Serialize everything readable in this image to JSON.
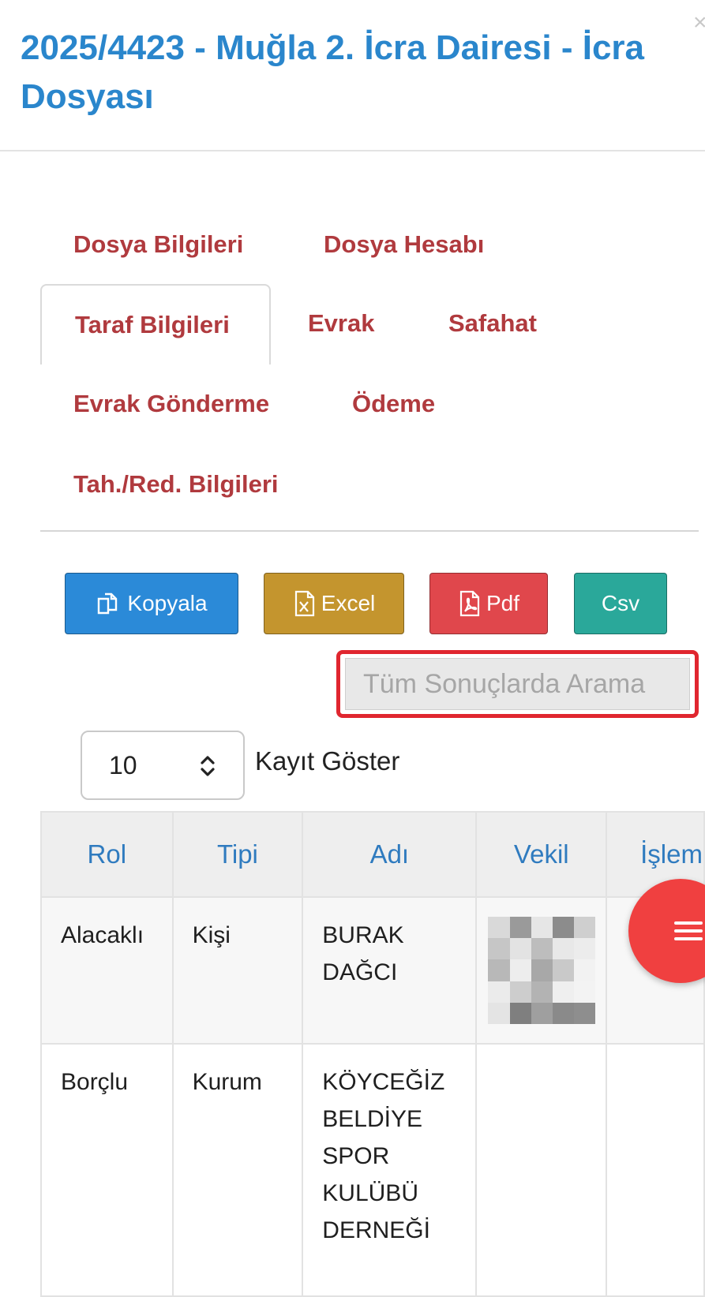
{
  "header": {
    "title": "2025/4423 - Muğla 2. İcra Dairesi - İcra Dosyası",
    "close_glyph": "×"
  },
  "tabs": [
    {
      "label": "Dosya Bilgileri",
      "active": false
    },
    {
      "label": "Dosya Hesabı",
      "active": false
    },
    {
      "label": "Taraf Bilgileri",
      "active": true
    },
    {
      "label": "Evrak",
      "active": false
    },
    {
      "label": "Safahat",
      "active": false
    },
    {
      "label": "Evrak Gönderme",
      "active": false
    },
    {
      "label": "Ödeme",
      "active": false
    },
    {
      "label": "Tah./Red. Bilgileri",
      "active": false
    }
  ],
  "export_buttons": [
    {
      "label": "Kopyala",
      "icon": "copy-icon",
      "color": "#2b8ad8"
    },
    {
      "label": "Excel",
      "icon": "excel-file-icon",
      "color": "#c4952e"
    },
    {
      "label": "Pdf",
      "icon": "pdf-file-icon",
      "color": "#e0474c"
    },
    {
      "label": "Csv",
      "icon": "",
      "color": "#2aa89a"
    }
  ],
  "search": {
    "placeholder": "Tüm Sonuçlarda Arama",
    "highlight_color": "#e0262f"
  },
  "page_length": {
    "value": "10",
    "label": "Kayıt Göster"
  },
  "table": {
    "columns": [
      "Rol",
      "Tipi",
      "Adı",
      "Vekil",
      "İşlem"
    ],
    "rows": [
      {
        "rol": "Alacaklı",
        "tipi": "Kişi",
        "adi": "BURAK DAĞCI",
        "vekil": "",
        "vekil_redacted": true
      },
      {
        "rol": "Borçlu",
        "tipi": "Kurum",
        "adi": "KÖYCEĞİZ BELDİYE SPOR KULÜBÜ DERNEĞİ",
        "vekil": "",
        "vekil_redacted": false
      }
    ]
  },
  "fab": {
    "icon": "hamburger-menu-icon",
    "color": "#f04040"
  },
  "colors": {
    "title_blue": "#2a86cc",
    "tab_red": "#b03a3e",
    "header_link_blue": "#2f7bbf"
  }
}
